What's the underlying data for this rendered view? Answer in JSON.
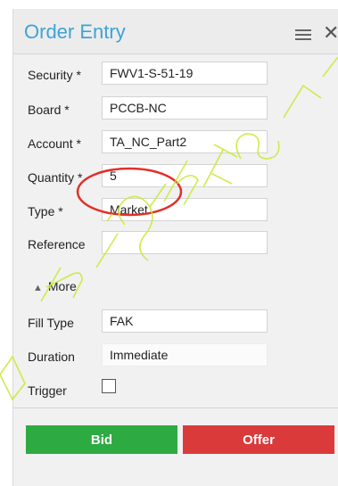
{
  "panel": {
    "title": "Order Entry",
    "menu_icon": "hamburger-menu-icon",
    "close_icon": "close-icon"
  },
  "form": {
    "security": {
      "label": "Security *",
      "value": "FWV1-S-51-19"
    },
    "board": {
      "label": "Board *",
      "value": "PCCB-NC"
    },
    "account": {
      "label": "Account *",
      "value": "TA_NC_Part2"
    },
    "quantity": {
      "label": "Quantity *",
      "value": "5"
    },
    "type": {
      "label": "Type *",
      "value": "Market"
    },
    "reference": {
      "label": "Reference",
      "value": ""
    }
  },
  "more": {
    "label": "More",
    "icon": "collapse-arrow-icon"
  },
  "extra": {
    "fill_type": {
      "label": "Fill Type",
      "value": "FAK"
    },
    "duration": {
      "label": "Duration",
      "value": "Immediate"
    },
    "trigger": {
      "label": "Trigger",
      "checked": false
    }
  },
  "actions": {
    "bid": "Bid",
    "offer": "Offer"
  },
  "colors": {
    "title": "#3ea3d6",
    "bid": "#2eaa42",
    "offer": "#da3a3a",
    "annotation": "#e0302a",
    "watermark": "#c8ea3a"
  }
}
